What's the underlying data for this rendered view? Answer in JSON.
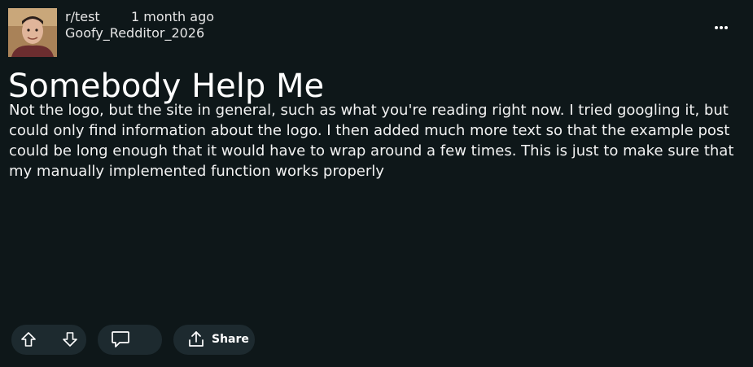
{
  "post": {
    "subreddit": "r/test",
    "time_ago": "1 month ago",
    "username": "Goofy_Redditor_2026",
    "title": "Somebody Help Me",
    "body": "Not the logo, but the site in general, such as what you're reading right now. I tried googling it, but could only find information about the logo. I then added much more text so that the example post could be long enough that it would have to wrap around a few times. This is just to make sure that my manually implemented function works properly"
  },
  "actions": {
    "share_label": "Share"
  },
  "icons": {
    "upvote": "arrow-up-outline-icon",
    "downvote": "arrow-down-outline-icon",
    "comment": "speech-bubble-icon",
    "share": "share-upload-icon",
    "more": "horizontal-ellipsis-icon"
  },
  "colors": {
    "background": "#0e1719",
    "pill": "#1d2a2f",
    "text": "#ffffff"
  }
}
